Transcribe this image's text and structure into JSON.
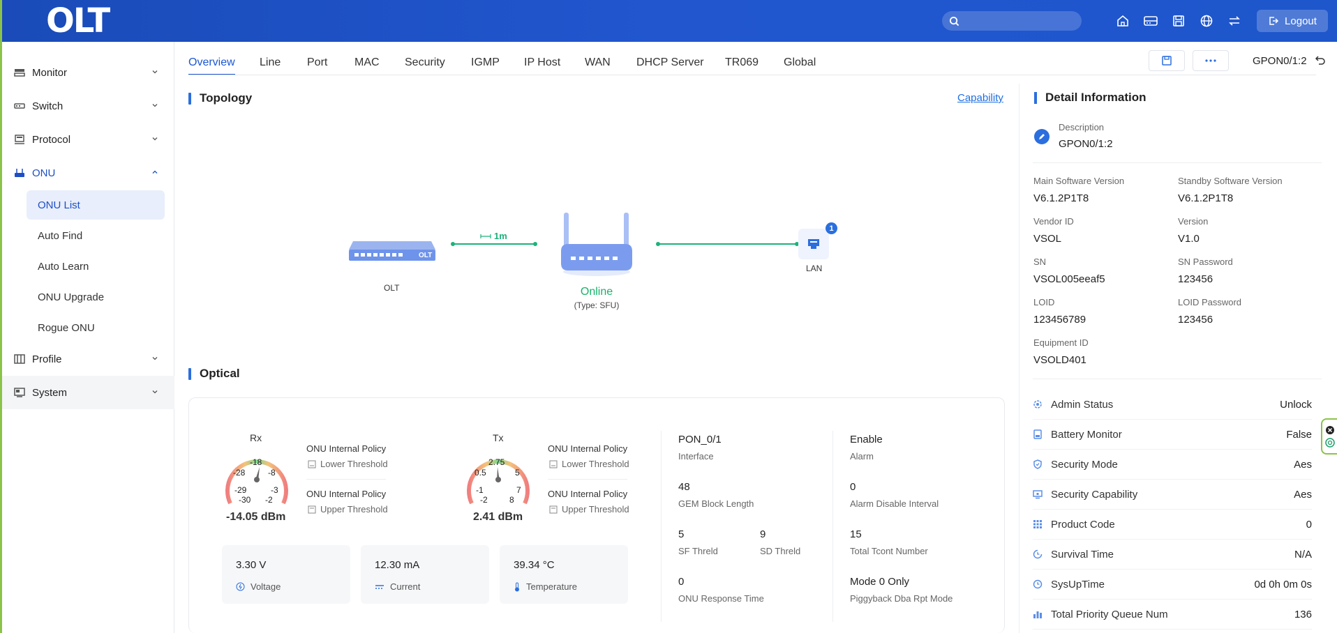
{
  "app": {
    "logo_text": "OLT",
    "logout_label": "Logout",
    "search_placeholder": ""
  },
  "header_icons": [
    "home-icon",
    "device-icon",
    "save-icon",
    "globe-icon",
    "transfer-icon"
  ],
  "sidebar": {
    "items": [
      {
        "label": "Monitor",
        "icon": "monitor-icon"
      },
      {
        "label": "Switch",
        "icon": "switch-icon"
      },
      {
        "label": "Protocol",
        "icon": "protocol-icon"
      },
      {
        "label": "ONU",
        "icon": "onu-icon",
        "expanded": true
      },
      {
        "label": "Profile",
        "icon": "profile-icon"
      },
      {
        "label": "System",
        "icon": "system-icon"
      }
    ],
    "onu_sub": [
      "ONU List",
      "Auto Find",
      "Auto Learn",
      "ONU Upgrade",
      "Rogue ONU"
    ]
  },
  "tabs": [
    "Overview",
    "Line",
    "Port",
    "MAC",
    "Security",
    "IGMP",
    "IP Host",
    "WAN",
    "DHCP Server",
    "TR069",
    "Global"
  ],
  "breadcrumb": "GPON0/1:2",
  "topology": {
    "title": "Topology",
    "capability_link": "Capability",
    "olt_label": "OLT",
    "olt_badge": "OLT",
    "distance": "1m",
    "status": "Online",
    "type": "(Type: SFU)",
    "lan_label": "LAN",
    "lan_count": "1"
  },
  "optical": {
    "title": "Optical",
    "rx": {
      "title": "Rx",
      "value": "-14.05 dBm",
      "ticks": [
        "-18",
        "-28",
        "-8",
        "-29",
        "-3",
        "-30",
        "-2"
      ]
    },
    "tx": {
      "title": "Tx",
      "value": "2.41 dBm",
      "ticks": [
        "2.75",
        "0.5",
        "5",
        "-1",
        "7",
        "-2",
        "8"
      ]
    },
    "policy_label": "ONU Internal Policy",
    "lower_threshold": "Lower Threshold",
    "upper_threshold": "Upper Threshold",
    "voltage": {
      "value": "3.30 V",
      "label": "Voltage"
    },
    "current": {
      "value": "12.30 mA",
      "label": "Current"
    },
    "temperature": {
      "value": "39.34 °C",
      "label": "Temperature"
    },
    "params": {
      "interface": {
        "value": "PON_0/1",
        "label": "Interface"
      },
      "alarm": {
        "value": "Enable",
        "label": "Alarm"
      },
      "gem_block": {
        "value": "48",
        "label": "GEM Block Length"
      },
      "alarm_disable": {
        "value": "0",
        "label": "Alarm Disable Interval"
      },
      "sf": {
        "value": "5",
        "label": "SF Threld"
      },
      "sd": {
        "value": "9",
        "label": "SD Threld"
      },
      "tcont": {
        "value": "15",
        "label": "Total Tcont Number"
      },
      "response": {
        "value": "0",
        "label": "ONU Response Time"
      },
      "piggyback": {
        "value": "Mode 0 Only",
        "label": "Piggyback Dba Rpt Mode"
      }
    }
  },
  "detail": {
    "title": "Detail Information",
    "description_label": "Description",
    "description_value": "GPON0/1:2",
    "main_sw_label": "Main Software Version",
    "main_sw": "V6.1.2P1T8",
    "standby_sw_label": "Standby Software Version",
    "standby_sw": "V6.1.2P1T8",
    "vendor_label": "Vendor ID",
    "vendor": "VSOL",
    "version_label": "Version",
    "version": "V1.0",
    "sn_label": "SN",
    "sn": "VSOL005eeaf5",
    "snpw_label": "SN Password",
    "snpw": "123456",
    "loid_label": "LOID",
    "loid": "123456789",
    "loidpw_label": "LOID Password",
    "loidpw": "123456",
    "equip_label": "Equipment ID",
    "equip": "VSOLD401",
    "rows": [
      {
        "label": "Admin Status",
        "value": "Unlock",
        "icon": "gear-icon"
      },
      {
        "label": "Battery Monitor",
        "value": "False",
        "icon": "battery-icon"
      },
      {
        "label": "Security Mode",
        "value": "Aes",
        "icon": "shield-icon"
      },
      {
        "label": "Security Capability",
        "value": "Aes",
        "icon": "monitor-lock-icon"
      },
      {
        "label": "Product Code",
        "value": "0",
        "icon": "grid-icon"
      },
      {
        "label": "Survival Time",
        "value": "N/A",
        "icon": "timer-icon"
      },
      {
        "label": "SysUpTime",
        "value": "0d 0h 0m 0s",
        "icon": "clock-icon"
      },
      {
        "label": "Total Priority Queue Num",
        "value": "136",
        "icon": "bars-icon"
      }
    ]
  },
  "colors": {
    "header": "#1e53c9",
    "accent": "#1d56d0",
    "online": "#17b26a",
    "sidebar_edge": "#8bc34a"
  }
}
